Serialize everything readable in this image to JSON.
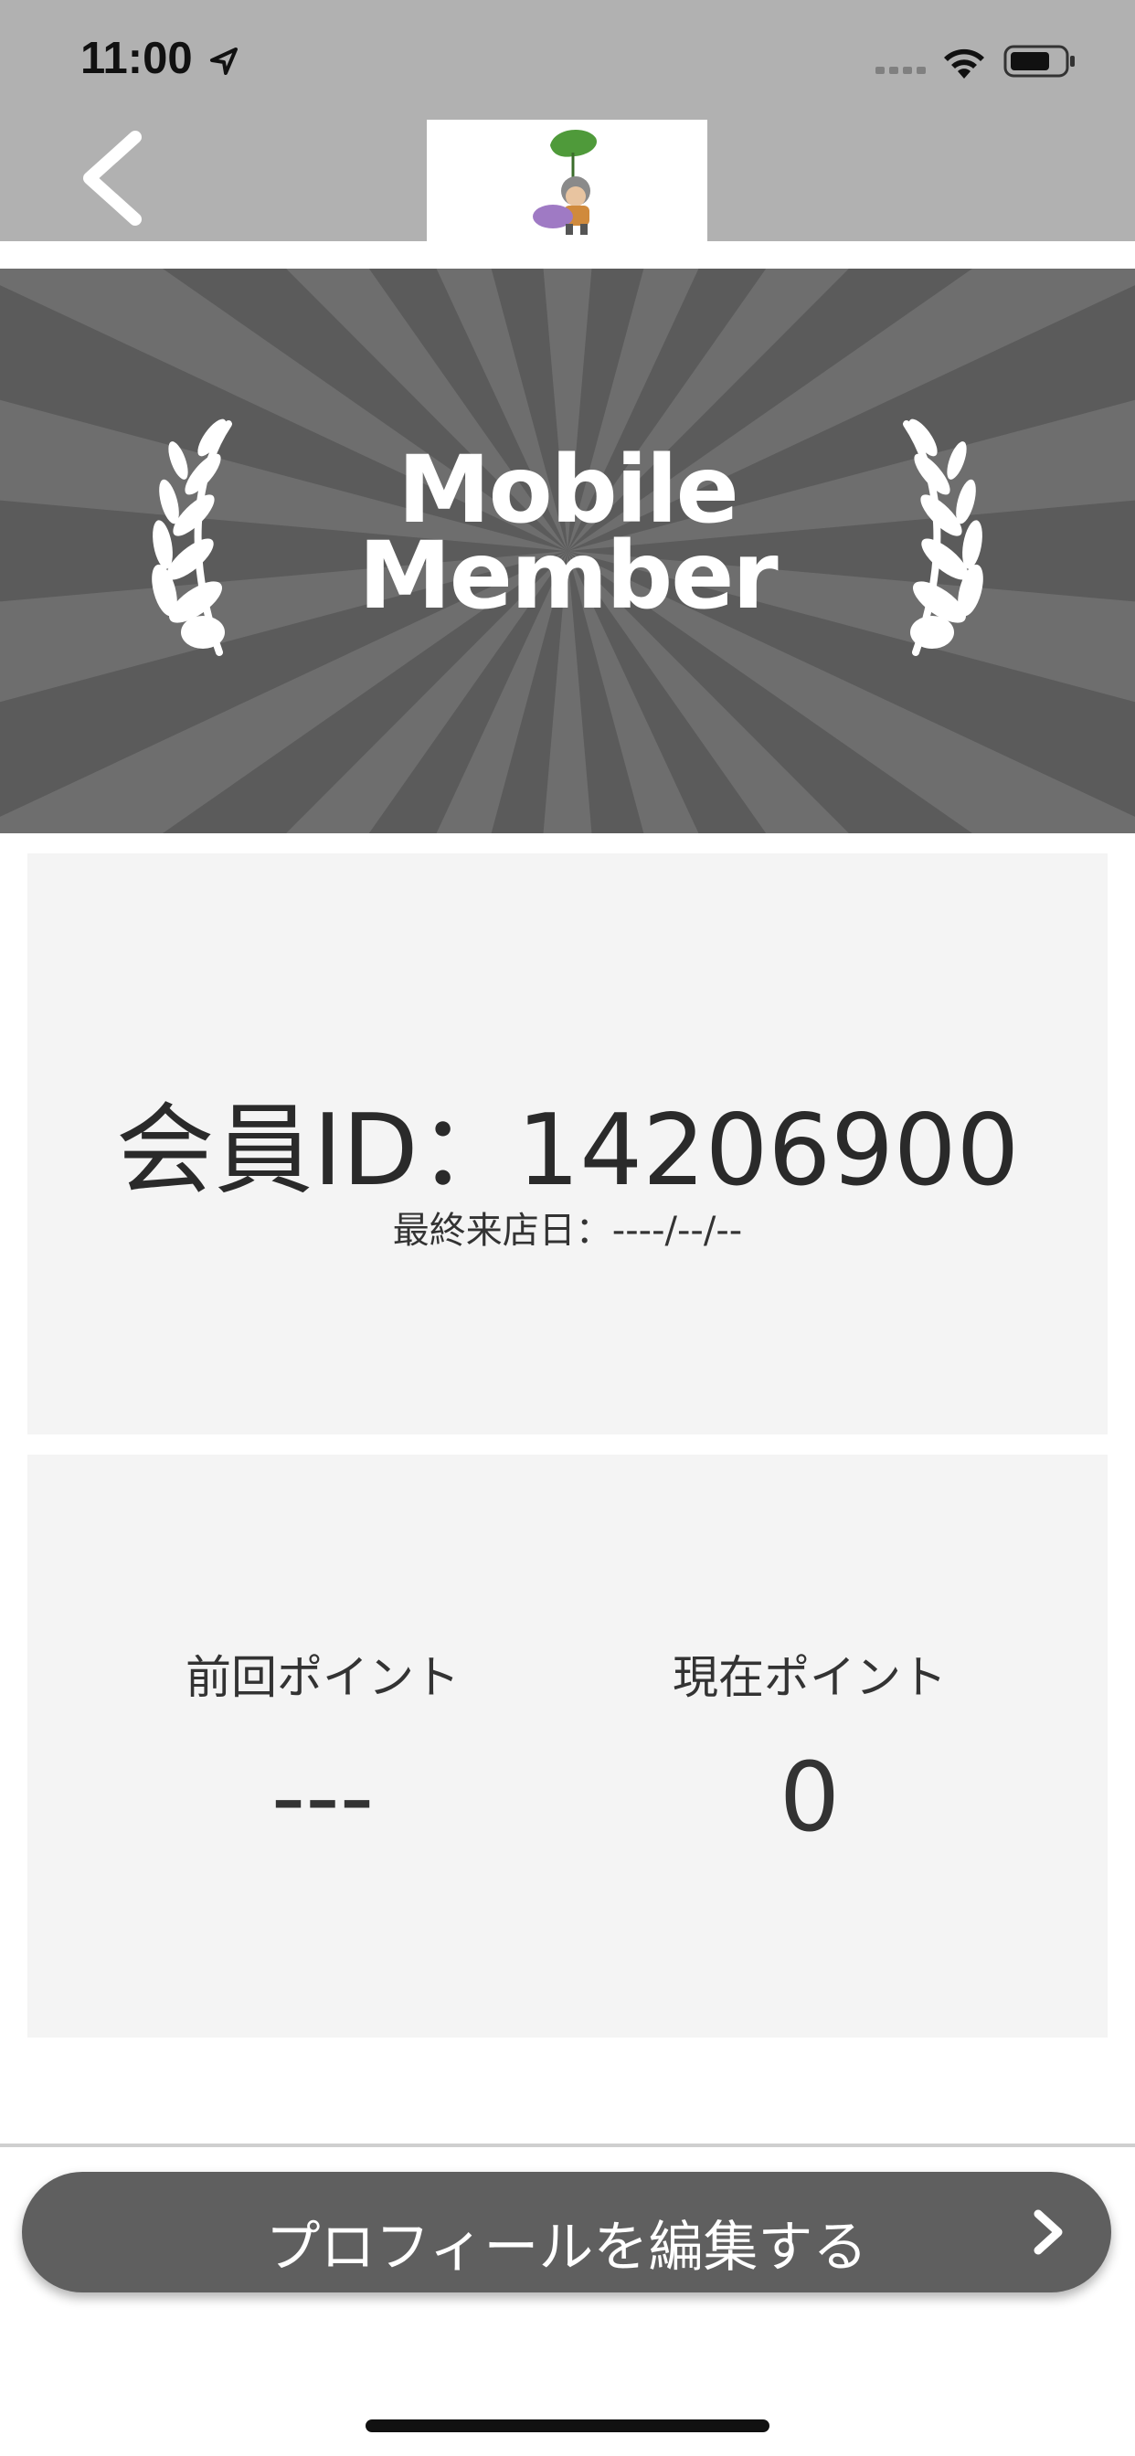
{
  "status_bar": {
    "time": "11:00"
  },
  "banner": {
    "title_line1": "Mobile",
    "title_line2": "Member"
  },
  "member": {
    "id_text": "会員ID：14206900",
    "last_visit": "最終来店日：----/--/--"
  },
  "points": {
    "previous_label": "前回ポイント",
    "previous_value": "---",
    "current_label": "現在ポイント",
    "current_value": "0"
  },
  "actions": {
    "edit_profile_label": "プロフィールを編集する"
  },
  "colors": {
    "nav_background": "#b1b1b1",
    "banner_dark": "#5b5b5b",
    "banner_rays": "#6e6e6e",
    "card_background": "#f4f4f4",
    "button_background": "#5f5f5f"
  }
}
